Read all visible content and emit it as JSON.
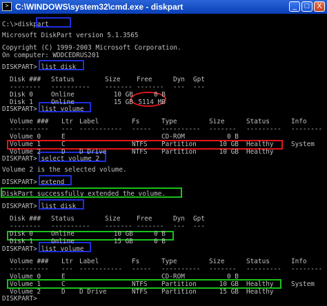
{
  "window": {
    "title": "C:\\WINDOWS\\system32\\cmd.exe - diskpart",
    "icon": "cmd-icon",
    "minimize_label": "_",
    "maximize_label": "□",
    "close_label": "X"
  },
  "console": {
    "prompt_initial": "C:\\>diskpart",
    "version": "Microsoft DiskPart version 5.1.3565",
    "copyright": "Copyright (C) 1999-2003 Microsoft Corporation.",
    "computer": "On computer: WDDCEDRUS201",
    "cmd1": "DISKPART> list disk",
    "disk_headers": [
      "Disk ###",
      "Status",
      "Size",
      "Free",
      "Dyn",
      "Gpt"
    ],
    "disk_sep": [
      "--------",
      "----------",
      "-------",
      "-------",
      "---",
      "---"
    ],
    "disks1": [
      {
        "disk": "Disk 0",
        "status": "Online",
        "size": "10 GB",
        "free": "0 B",
        "dyn": "",
        "gpt": ""
      },
      {
        "disk": "Disk 1",
        "status": "Online",
        "size": "15 GB",
        "free": "5114 MB",
        "dyn": "",
        "gpt": ""
      }
    ],
    "cmd2": "DISKPART> list volume",
    "vol_headers": [
      "Volume ###",
      "Ltr",
      "Label",
      "Fs",
      "Type",
      "Size",
      "Status",
      "Info"
    ],
    "vol_sep": [
      "----------",
      "---",
      "-----------",
      "-----",
      "----------",
      "-------",
      "---------",
      "--------"
    ],
    "volumes1": [
      {
        "vol": "Volume 0",
        "ltr": "E",
        "label": "",
        "fs": "",
        "type": "CD-ROM",
        "size": "0 B",
        "status": "",
        "info": ""
      },
      {
        "vol": "Volume 1",
        "ltr": "C",
        "label": "",
        "fs": "NTFS",
        "type": "Partition",
        "size": "10 GB",
        "status": "Healthy",
        "info": "System"
      },
      {
        "vol": "Volume 2",
        "ltr": "D",
        "label": "D Drive",
        "fs": "NTFS",
        "type": "Partition",
        "size": "10 GB",
        "status": "Healthy",
        "info": ""
      }
    ],
    "cmd3": "DISKPART> select volume 2",
    "select_msg": "Volume 2 is the selected volume.",
    "cmd4": "DISKPART> extend",
    "extend_msg": "DiskPart successfully extended the volume.",
    "cmd5": "DISKPART> list disk",
    "disks2": [
      {
        "disk": "Disk 0",
        "status": "Online",
        "size": "10 GB",
        "free": "0 B",
        "dyn": "",
        "gpt": ""
      },
      {
        "disk": "Disk 1",
        "status": "Online",
        "size": "15 GB",
        "free": "0 B",
        "dyn": "",
        "gpt": ""
      }
    ],
    "cmd6": "DISKPART> list volume",
    "volumes2": [
      {
        "vol": "Volume 0",
        "ltr": "E",
        "label": "",
        "fs": "",
        "type": "CD-ROM",
        "size": "0 B",
        "status": "",
        "info": ""
      },
      {
        "vol": "Volume 1",
        "ltr": "C",
        "label": "",
        "fs": "NTFS",
        "type": "Partition",
        "size": "10 GB",
        "status": "Healthy",
        "info": "System"
      },
      {
        "vol": "Volume 2",
        "ltr": "D",
        "label": "D Drive",
        "fs": "NTFS",
        "type": "Partition",
        "size": "15 GB",
        "status": "Healthy",
        "info": ""
      }
    ],
    "final_prompt": "DISKPART>"
  },
  "colors": {
    "console_bg": "#000000",
    "console_text": "#c0c0c0",
    "titlebar": "#0a3fb6",
    "highlight_blue": "#1d2fe0",
    "highlight_red": "#e3161b",
    "highlight_green": "#19c219"
  }
}
